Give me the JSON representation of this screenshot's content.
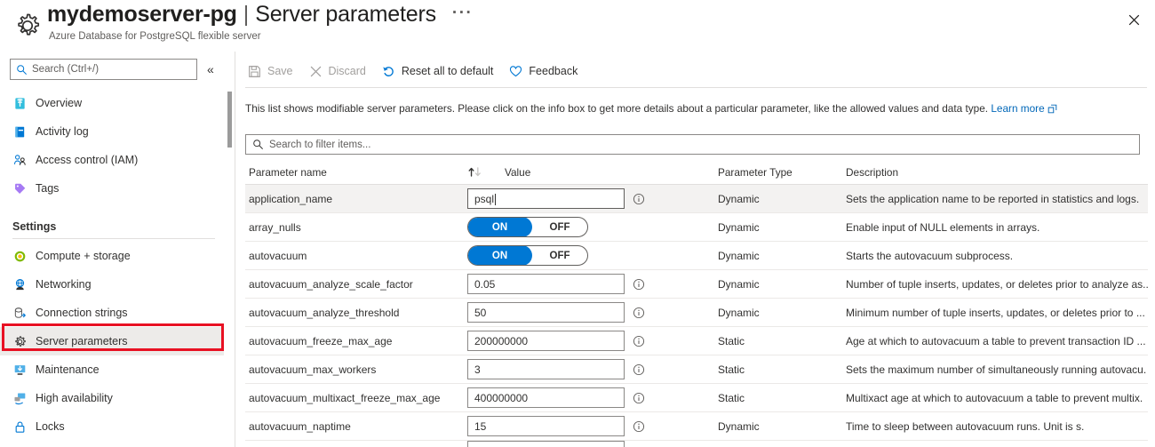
{
  "header": {
    "icon": "gear-icon",
    "title": "mydemoserver-pg",
    "separator": "|",
    "subtitle_inline": "Server parameters",
    "ellipsis": "···",
    "subtitle": "Azure Database for PostgreSQL flexible server",
    "close_label": "✕"
  },
  "sidebar": {
    "search": {
      "placeholder": "Search (Ctrl+/)",
      "icon": "search-icon"
    },
    "collapse": {
      "label": "«",
      "icon": "chevron-double-left-icon"
    },
    "items": [
      {
        "label": "Overview",
        "icon": "database-icon",
        "selected": false
      },
      {
        "label": "Activity log",
        "icon": "activity-log-icon",
        "selected": false
      },
      {
        "label": "Access control (IAM)",
        "icon": "access-control-icon",
        "selected": false
      },
      {
        "label": "Tags",
        "icon": "tag-icon",
        "selected": false
      }
    ],
    "section_label": "Settings",
    "settings_items": [
      {
        "label": "Compute + storage",
        "icon": "compute-storage-icon",
        "selected": false
      },
      {
        "label": "Networking",
        "icon": "networking-icon",
        "selected": false
      },
      {
        "label": "Connection strings",
        "icon": "connection-strings-icon",
        "selected": false
      },
      {
        "label": "Server parameters",
        "icon": "gear-icon",
        "selected": true
      },
      {
        "label": "Maintenance",
        "icon": "maintenance-icon",
        "selected": false
      },
      {
        "label": "High availability",
        "icon": "high-availability-icon",
        "selected": false
      },
      {
        "label": "Locks",
        "icon": "lock-icon",
        "selected": false
      }
    ],
    "highlight_color": "#e81123"
  },
  "toolbar": {
    "buttons": [
      {
        "label": "Save",
        "icon": "save-icon",
        "disabled": true
      },
      {
        "label": "Discard",
        "icon": "discard-x-icon",
        "disabled": true
      },
      {
        "label": "Reset all to default",
        "icon": "reset-icon",
        "disabled": false
      },
      {
        "label": "Feedback",
        "icon": "heart-icon",
        "disabled": false
      }
    ]
  },
  "info": {
    "text": "This list shows modifiable server parameters. Please click on the info box to get more details about a particular parameter, like the allowed values and data type.",
    "link_label": "Learn more",
    "link_icon": "external-link-icon"
  },
  "filter": {
    "placeholder": "Search to filter items...",
    "icon": "search-icon"
  },
  "table": {
    "columns": [
      "Parameter name",
      "Value",
      "Parameter Type",
      "Description"
    ],
    "sort": {
      "column": "Parameter name",
      "direction": "ascending",
      "icon": "sort-arrows-icon"
    },
    "rows": [
      {
        "name": "application_name",
        "control": "text",
        "value": "psql",
        "focused": true,
        "type": "Dynamic",
        "description": "Sets the application name to be reported in statistics and logs.",
        "selected": true
      },
      {
        "name": "array_nulls",
        "control": "toggle",
        "value": "ON",
        "toggle_on_label": "ON",
        "toggle_off_label": "OFF",
        "type": "Dynamic",
        "description": "Enable input of NULL elements in arrays.",
        "selected": false
      },
      {
        "name": "autovacuum",
        "control": "toggle",
        "value": "ON",
        "toggle_on_label": "ON",
        "toggle_off_label": "OFF",
        "type": "Dynamic",
        "description": "Starts the autovacuum subprocess.",
        "selected": false
      },
      {
        "name": "autovacuum_analyze_scale_factor",
        "control": "text",
        "value": "0.05",
        "type": "Dynamic",
        "description": "Number of tuple inserts, updates, or deletes prior to analyze as..",
        "selected": false
      },
      {
        "name": "autovacuum_analyze_threshold",
        "control": "text",
        "value": "50",
        "type": "Dynamic",
        "description": "Minimum number of tuple inserts, updates, or deletes prior to ...",
        "selected": false
      },
      {
        "name": "autovacuum_freeze_max_age",
        "control": "text",
        "value": "200000000",
        "type": "Static",
        "description": "Age at which to autovacuum a table to prevent transaction ID ...",
        "selected": false
      },
      {
        "name": "autovacuum_max_workers",
        "control": "text",
        "value": "3",
        "type": "Static",
        "description": "Sets the maximum number of simultaneously running autovacu.",
        "selected": false
      },
      {
        "name": "autovacuum_multixact_freeze_max_age",
        "control": "text",
        "value": "400000000",
        "type": "Static",
        "description": "Multixact age at which to autovacuum a table to prevent multix.",
        "selected": false
      },
      {
        "name": "autovacuum_naptime",
        "control": "text",
        "value": "15",
        "type": "Dynamic",
        "description": "Time to sleep between autovacuum runs. Unit is s.",
        "selected": false
      }
    ],
    "info_icon": "info-circle-icon"
  },
  "colors": {
    "accent": "#0078d4",
    "link": "#0067b8",
    "annotation": "#e81123",
    "selected_row": "#f3f2f1",
    "border": "#8a8886"
  }
}
